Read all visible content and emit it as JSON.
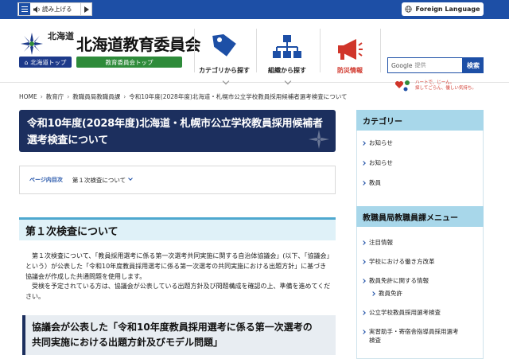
{
  "topbar": {
    "read_aloud": "読み上げる",
    "foreign_language": "Foreign Language"
  },
  "header": {
    "pref_name": "北海道",
    "pref_top": "北海道トップ",
    "board_title": "北海道教育委員会",
    "board_top": "教育委員会トップ",
    "nav": [
      {
        "label": "カテゴリから探す",
        "icon": "tag-icon"
      },
      {
        "label": "組織から探す",
        "icon": "org-chart-icon"
      },
      {
        "label": "防災情報",
        "icon": "megaphone-icon"
      }
    ],
    "search": {
      "google": "Google",
      "placeholder": "提供",
      "button": "検索"
    },
    "slogan": [
      "ハートで、じーん。",
      "探してごらん、優しい気持ち。"
    ]
  },
  "breadcrumb": [
    "HOME",
    "教育庁",
    "教職員局教職員課",
    "令和10年度(2028年度)北海道・札幌市公立学校教員採用候補者選考検査について"
  ],
  "main": {
    "title_line1": "令和10年度(2028年度)北海道・札幌市公立学校教員採用候補者",
    "title_line2": "選考検査について",
    "toc_label": "ページ内目次",
    "toc_link": "第１次検査について",
    "section_heading": "第１次検査について",
    "para1": "第１次検査について、「教員採用選考に係る第一次選考共同実施に関する自治体協議会」(以下、「協議会」という）が公表した「令和10年度教員採用選考に係る第一次選考の共同実施における出題方針」に基づき協議会が作成した共通問題を使用します。",
    "para2": "受検を予定されている方は、協議会が公表している出題方針及び問題構成を確認の上、準備を進めてください。",
    "subheading_line1": "協議会が公表した「令和10年度教員採用選考に係る第一次選考の",
    "subheading_line2": "共同実施における出題方針及びモデル問題」"
  },
  "sidebar": {
    "category_title": "カテゴリー",
    "category_items": [
      "お知らせ",
      "お知らせ",
      "教員"
    ],
    "menu_title": "教職員局教職員課メニュー",
    "menu_items": [
      "注目情報",
      "学校における働き方改革",
      "教員免許に関する情報",
      "教員免許",
      "公立学校教員採用選考検査",
      "実習助手・寄宿舎指導員採用選考",
      "検査"
    ]
  },
  "colors": {
    "brand_blue": "#1d4fa6",
    "navy": "#1c2f5e",
    "green": "#2e8b3a",
    "red": "#d0352a",
    "light_blue": "#a8d7ea"
  }
}
